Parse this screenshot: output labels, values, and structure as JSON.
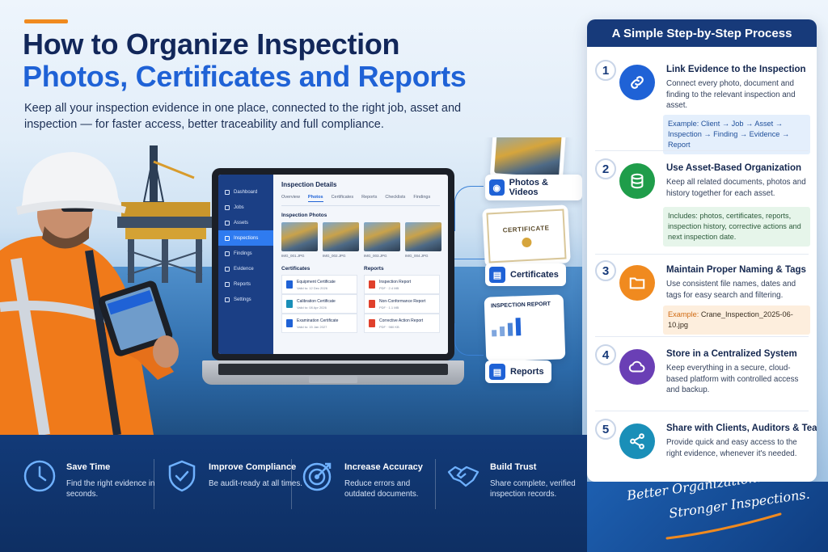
{
  "header": {
    "title_line1_a": "How to ",
    "title_line1_b": "Organize Inspection",
    "title_line2": "Photos, Certificates and Reports",
    "subtitle": "Keep all your inspection evidence in one place, connected to the right job, asset and inspection — for faster access, better traceability and full compliance."
  },
  "laptop": {
    "sidebar": [
      "Dashboard",
      "Jobs",
      "Assets",
      "Inspections",
      "Findings",
      "Evidence",
      "Reports",
      "Settings"
    ],
    "active_nav": "Inspections",
    "title": "Inspection Details",
    "tabs": [
      "Overview",
      "Photos",
      "Certificates",
      "Reports",
      "Checklists",
      "Findings"
    ],
    "active_tab": "Photos",
    "photos_heading": "Inspection Photos",
    "photos": [
      "IMG_001.JPG",
      "IMG_002.JPG",
      "IMG_003.JPG",
      "IMG_004.JPG"
    ],
    "certificates_heading": "Certificates",
    "certificates": [
      {
        "title": "Equipment Certificate",
        "sub": "Valid to: 12 Dec 2026"
      },
      {
        "title": "Calibration Certificate",
        "sub": "Valid to: 08 Apr 2026"
      },
      {
        "title": "Examination Certificate",
        "sub": "Valid to: 15 Jan 2027"
      }
    ],
    "reports_heading": "Reports",
    "reports": [
      {
        "title": "Inspection Report",
        "sub": "PDF · 2.4 MB"
      },
      {
        "title": "Non-Conformance Report",
        "sub": "PDF · 1.1 MB"
      },
      {
        "title": "Corrective Action Report",
        "sub": "PDF · 980 KB"
      }
    ]
  },
  "evidence": {
    "photos_label": "Photos & Videos",
    "certificates_label": "Certificates",
    "certificate_word": "CERTIFICATE",
    "reports_label": "Reports",
    "report_doc_title": "INSPECTION REPORT"
  },
  "panel": {
    "heading": "A Simple Step-by-Step Process",
    "steps": [
      {
        "num": "1",
        "title": "Link Evidence to the Inspection",
        "desc": "Connect every photo, document and finding to the relevant inspection and asset.",
        "box": "Example: Client → Job → Asset → Inspection → Finding → Evidence → Report",
        "color": "#1f62d6",
        "icon": "link-icon"
      },
      {
        "num": "2",
        "title": "Use Asset-Based Organization",
        "desc": "Keep all related documents, photos and history together for each asset.",
        "box": "Includes: photos, certificates, reports, inspection history, corrective actions and next inspection date.",
        "color": "#1f9d4a",
        "icon": "database-icon"
      },
      {
        "num": "3",
        "title": "Maintain Proper Naming & Tags",
        "desc": "Use consistent file names, dates and tags for easy search and filtering.",
        "box_prefix": "Example:",
        "box": " Crane_Inspection_2025-06-10.jpg",
        "color": "#f08a1f",
        "icon": "folder-icon"
      },
      {
        "num": "4",
        "title": "Store in a Centralized System",
        "desc": "Keep everything in a secure, cloud-based platform with controlled access and backup.",
        "color": "#6a3fb5",
        "icon": "cloud-icon"
      },
      {
        "num": "5",
        "title": "Share with Clients, Auditors & Teams",
        "desc": "Provide quick and easy access to the right evidence, whenever it's needed.",
        "color": "#1a8fb8",
        "icon": "share-icon"
      }
    ]
  },
  "benefits": [
    {
      "title": "Save Time",
      "desc": "Find the right evidence in seconds.",
      "icon": "clock-icon"
    },
    {
      "title": "Improve Compliance",
      "desc": "Be audit-ready at all times.",
      "icon": "shield-check-icon"
    },
    {
      "title": "Increase Accuracy",
      "desc": "Reduce errors and outdated documents.",
      "icon": "target-icon"
    },
    {
      "title": "Build Trust",
      "desc": "Share complete, verified inspection records.",
      "icon": "handshake-icon"
    }
  ],
  "slogan": {
    "line1": "Better Organization.",
    "line2": "Stronger Inspections."
  },
  "colors": {
    "navy": "#12275a",
    "brand_blue": "#1f62d6",
    "accent_orange": "#f08a1f",
    "band": "#123a78"
  }
}
